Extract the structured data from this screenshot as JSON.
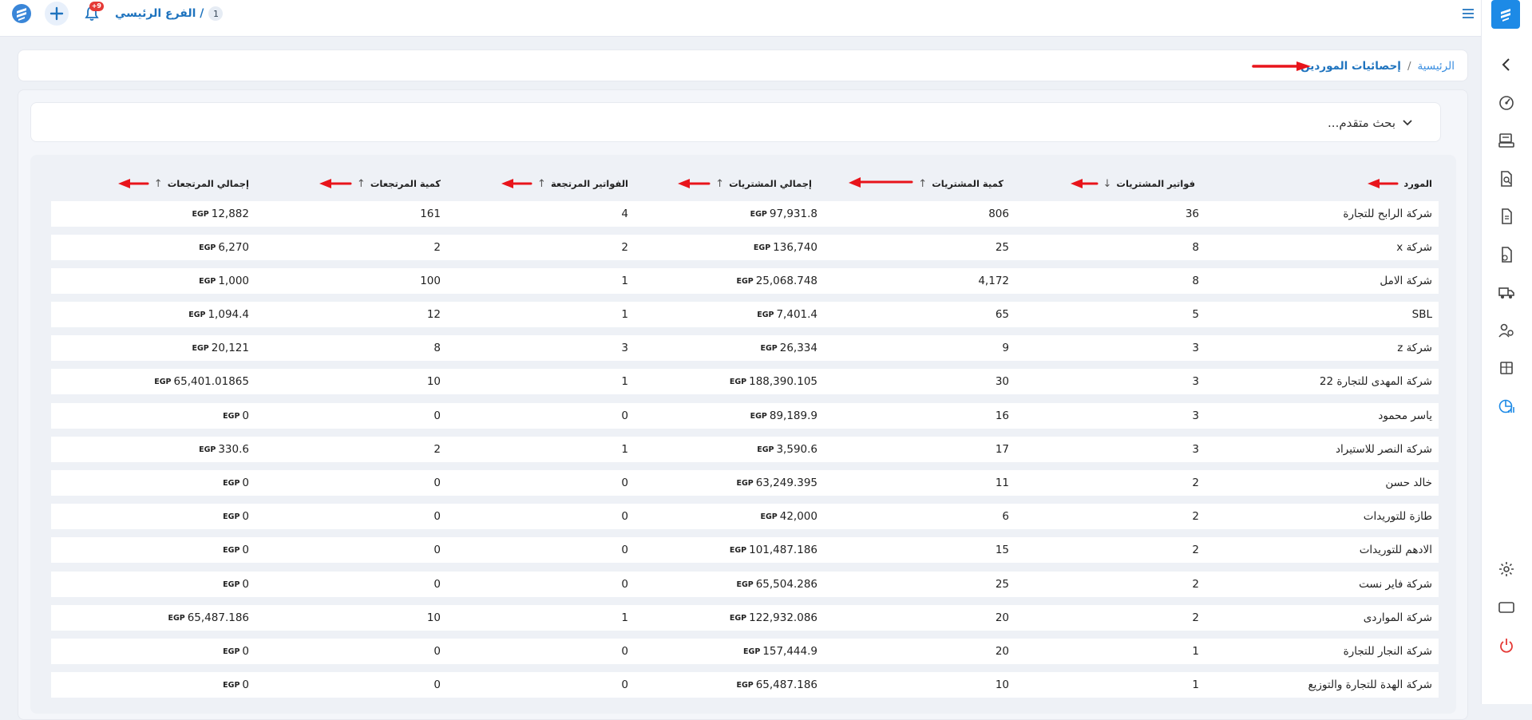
{
  "topbar": {
    "branch_name": "الفرع الرئيسي /",
    "branch_number": "1",
    "notifications_badge": "+9"
  },
  "breadcrumb": {
    "home": "الرئيسية",
    "separator": "/",
    "current": "إحصائيات الموردين"
  },
  "advanced_search": {
    "label": "بحث متقدم..."
  },
  "table": {
    "currency": "EGP",
    "headers": {
      "supplier": "المورد",
      "purchase_invoices": "فواتير المشتريات",
      "purchase_quantity": "كمية المشتريات",
      "purchase_total": "إجمالي المشتريات",
      "returned_invoices": "الفواتير المرتجعة",
      "returns_quantity": "كمية المرتجعات",
      "returns_total": "إجمالي المرتجعات"
    },
    "rows": [
      {
        "supplier": "شركة الرابح للتجارة",
        "purchase_invoices": "36",
        "purchase_quantity": "806",
        "purchase_total": "97,931.8",
        "returned_invoices": "4",
        "returns_quantity": "161",
        "returns_total": "12,882"
      },
      {
        "supplier": "شركة x",
        "purchase_invoices": "8",
        "purchase_quantity": "25",
        "purchase_total": "136,740",
        "returned_invoices": "2",
        "returns_quantity": "2",
        "returns_total": "6,270"
      },
      {
        "supplier": "شركة الامل",
        "purchase_invoices": "8",
        "purchase_quantity": "4,172",
        "purchase_total": "25,068.748",
        "returned_invoices": "1",
        "returns_quantity": "100",
        "returns_total": "1,000"
      },
      {
        "supplier": "SBL",
        "purchase_invoices": "5",
        "purchase_quantity": "65",
        "purchase_total": "7,401.4",
        "returned_invoices": "1",
        "returns_quantity": "12",
        "returns_total": "1,094.4"
      },
      {
        "supplier": "شركة z",
        "purchase_invoices": "3",
        "purchase_quantity": "9",
        "purchase_total": "26,334",
        "returned_invoices": "3",
        "returns_quantity": "8",
        "returns_total": "20,121"
      },
      {
        "supplier": "شركة المهدى للتجارة 22",
        "purchase_invoices": "3",
        "purchase_quantity": "30",
        "purchase_total": "188,390.105",
        "returned_invoices": "1",
        "returns_quantity": "10",
        "returns_total": "65,401.01865"
      },
      {
        "supplier": "ياسر محمود",
        "purchase_invoices": "3",
        "purchase_quantity": "16",
        "purchase_total": "89,189.9",
        "returned_invoices": "0",
        "returns_quantity": "0",
        "returns_total": "0"
      },
      {
        "supplier": "شركة النصر للاستيراد",
        "purchase_invoices": "3",
        "purchase_quantity": "17",
        "purchase_total": "3,590.6",
        "returned_invoices": "1",
        "returns_quantity": "2",
        "returns_total": "330.6"
      },
      {
        "supplier": "خالد حسن",
        "purchase_invoices": "2",
        "purchase_quantity": "11",
        "purchase_total": "63,249.395",
        "returned_invoices": "0",
        "returns_quantity": "0",
        "returns_total": "0"
      },
      {
        "supplier": "طازة للتوريدات",
        "purchase_invoices": "2",
        "purchase_quantity": "6",
        "purchase_total": "42,000",
        "returned_invoices": "0",
        "returns_quantity": "0",
        "returns_total": "0"
      },
      {
        "supplier": "الادهم للتوريدات",
        "purchase_invoices": "2",
        "purchase_quantity": "15",
        "purchase_total": "101,487.186",
        "returned_invoices": "0",
        "returns_quantity": "0",
        "returns_total": "0"
      },
      {
        "supplier": "شركة فاير نست",
        "purchase_invoices": "2",
        "purchase_quantity": "25",
        "purchase_total": "65,504.286",
        "returned_invoices": "0",
        "returns_quantity": "0",
        "returns_total": "0"
      },
      {
        "supplier": "شركة المواردى",
        "purchase_invoices": "2",
        "purchase_quantity": "20",
        "purchase_total": "122,932.086",
        "returned_invoices": "1",
        "returns_quantity": "10",
        "returns_total": "65,487.186"
      },
      {
        "supplier": "شركة النجار للتجارة",
        "purchase_invoices": "1",
        "purchase_quantity": "20",
        "purchase_total": "157,444.9",
        "returned_invoices": "0",
        "returns_quantity": "0",
        "returns_total": "0"
      },
      {
        "supplier": "شركة الهدة للتجارة والتوزيع",
        "purchase_invoices": "1",
        "purchase_quantity": "10",
        "purchase_total": "65,487.186",
        "returned_invoices": "0",
        "returns_quantity": "0",
        "returns_total": "0"
      }
    ]
  },
  "sidebar": {
    "icons": [
      "dashboard-icon",
      "cash-register-icon",
      "search-document-icon",
      "documents-icon",
      "invoice-return-icon",
      "truck-icon",
      "users-icon",
      "inventory-icon",
      "reports-chart-icon"
    ],
    "bottom_icons": [
      "settings-icon",
      "window-icon",
      "power-icon"
    ]
  },
  "colors": {
    "brand": "#1d8ae6",
    "link": "#1e73be",
    "annotation_arrow": "#e8141b"
  }
}
